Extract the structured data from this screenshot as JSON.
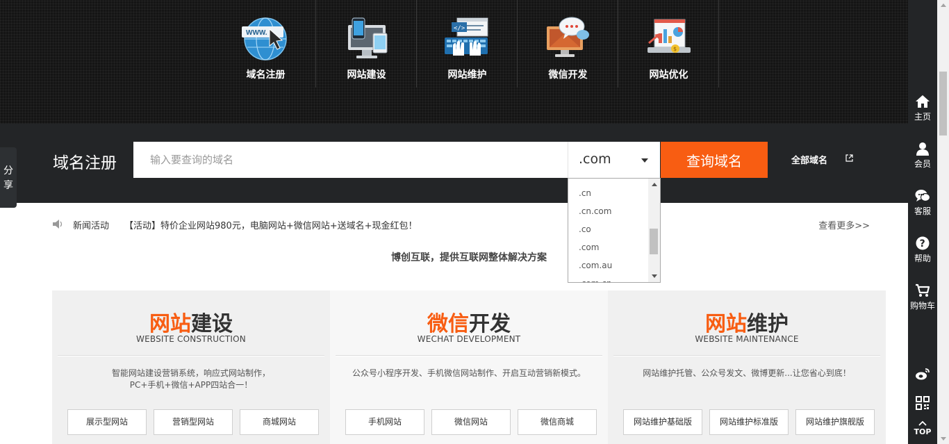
{
  "colors": {
    "accent": "#f85d12",
    "dark_bar": "#232527",
    "hero_bg": "#151515"
  },
  "services": [
    {
      "label": "域名注册",
      "icon": "globe-www-icon"
    },
    {
      "label": "网站建设",
      "icon": "devices-icon"
    },
    {
      "label": "网站维护",
      "icon": "keyboard-code-icon"
    },
    {
      "label": "微信开发",
      "icon": "chat-monitor-icon"
    },
    {
      "label": "网站优化",
      "icon": "analytics-laptop-icon"
    }
  ],
  "search": {
    "title": "域名注册",
    "placeholder": "输入要查询的域名",
    "selected_tld": ".com",
    "button": "查询域名",
    "all_domains": "全部域名",
    "tld_options": [
      ".cn",
      ".cn.com",
      ".co",
      ".com",
      ".com.au",
      ".com.cn"
    ]
  },
  "news": {
    "label": "新闻活动",
    "text": "【活动】特价企业网站980元，电脑网站+微信网站+送域名+现金红包！",
    "more": "查看更多>>"
  },
  "tagline": "博创互联，提供互联网整体解决方案",
  "cards": [
    {
      "title_hl": "网站",
      "title_rest": "建设",
      "en": "WEBSITE CONSTRUCTION",
      "desc1": "智能网站建设营销系统，响应式网站制作，",
      "desc2": "PC+手机+微信+APP四站合一！",
      "buttons": [
        "展示型网站",
        "营销型网站",
        "商城网站"
      ]
    },
    {
      "title_hl": "微信",
      "title_rest": "开发",
      "en": "WECHAT DEVELOPMENT",
      "desc1": "公众号小程序开发、手机微信网站制作、开启互动营销新模式。",
      "desc2": "",
      "buttons": [
        "手机网站",
        "微信网站",
        "微信商城"
      ]
    },
    {
      "title_hl": "网站",
      "title_rest": "维护",
      "en": "WEBSITE MAINTENANCE",
      "desc1": "网站维护托管、公众号发文、微博更新...让您省心到底！",
      "desc2": "",
      "buttons": [
        "网站维护基础版",
        "网站维护标准版",
        "网站维护旗舰版"
      ]
    }
  ],
  "sidebar": {
    "home": "主页",
    "member": "会员",
    "service": "客服",
    "help": "帮助",
    "cart": "购物车",
    "top": "TOP"
  },
  "share": {
    "line1": "分",
    "line2": "享"
  }
}
